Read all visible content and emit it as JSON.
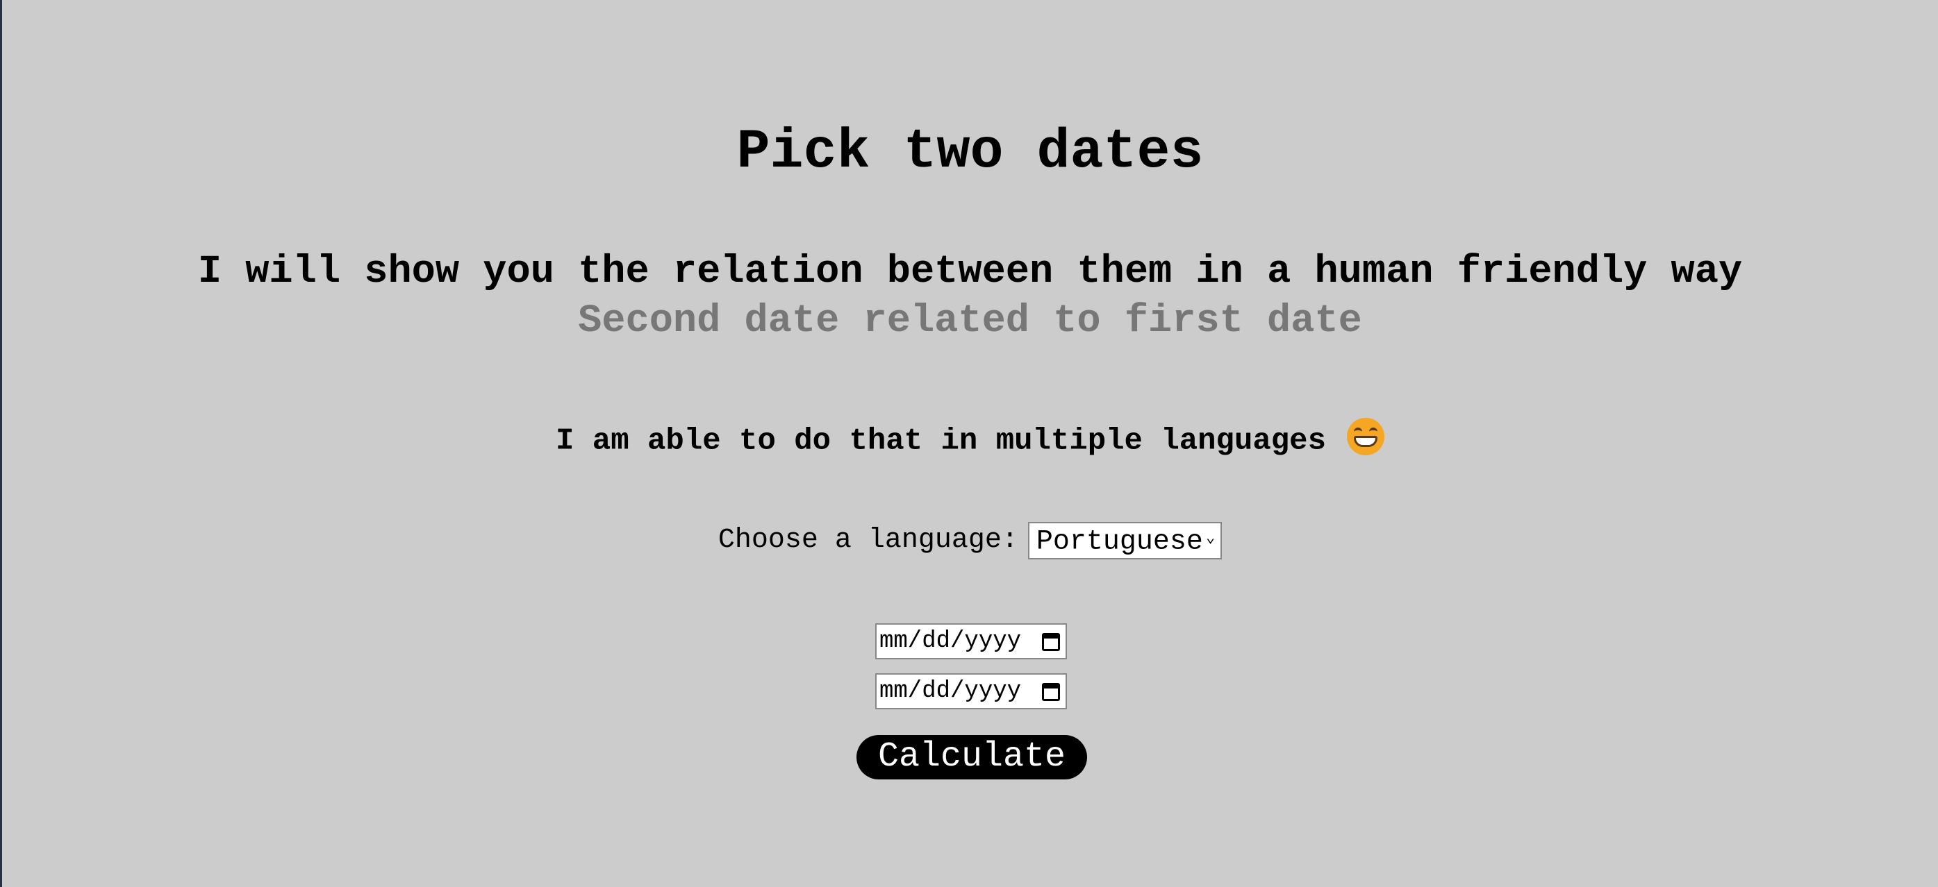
{
  "heading": "Pick two dates",
  "subtitle": "I will show you the relation between them in a human friendly way",
  "hint": "Second date related to first date",
  "languages_note": "I am able to do that in multiple languages",
  "emoji": "grinning-face-icon",
  "language_selector": {
    "label": "Choose a language:",
    "selected": "Portuguese"
  },
  "date_inputs": [
    {
      "placeholder": "mm/dd/yyyy"
    },
    {
      "placeholder": "mm/dd/yyyy"
    }
  ],
  "calculate_label": "Calculate",
  "colors": {
    "background": "#cccccc",
    "hint_text": "#777777",
    "button_bg": "#000000",
    "button_text": "#ffffff"
  }
}
